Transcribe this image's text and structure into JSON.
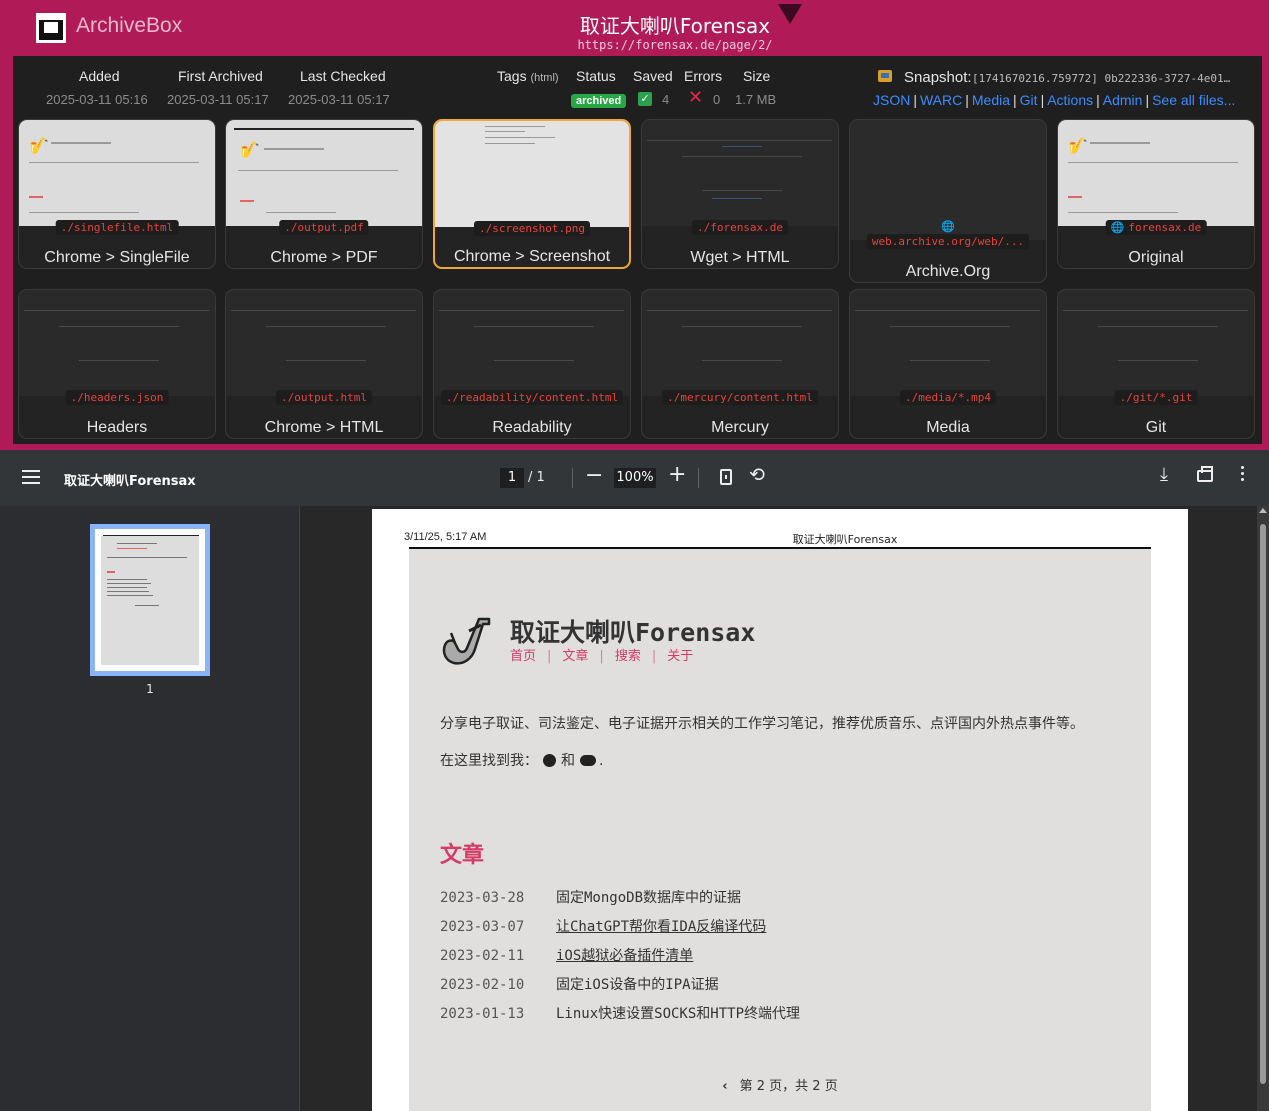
{
  "archivebox": {
    "brand": "ArchiveBox",
    "title": "取证大喇叭Forensax",
    "url": "https://forensax.de/page/2/",
    "meta": {
      "added_label": "Added",
      "added": "2025-03-11 05:16",
      "first_label": "First Archived",
      "first": "2025-03-11 05:17",
      "last_label": "Last Checked",
      "last": "2025-03-11 05:17",
      "tags_label": "Tags",
      "tags_sub": "(html)",
      "status_label": "Status",
      "status": "archived",
      "saved_label": "Saved",
      "saved": "4",
      "errors_label": "Errors",
      "errors": "0",
      "size_label": "Size",
      "size": "1.7 MB"
    },
    "snapshot": {
      "label": "Snapshot:",
      "id": "[1741670216.759772] 0b222336-3727-4e01-8fdd…",
      "links": [
        "JSON",
        "WARC",
        "Media",
        "Git",
        "Actions",
        "Admin",
        "See all files..."
      ]
    },
    "cards": [
      {
        "path": "./singlefile.html",
        "label": "Chrome > SingleFile"
      },
      {
        "path": "./output.pdf",
        "label": "Chrome > PDF"
      },
      {
        "path": "./screenshot.png",
        "label": "Chrome > Screenshot"
      },
      {
        "path": "./forensax.de",
        "label": "Wget > HTML"
      },
      {
        "path": "web.archive.org/web/...",
        "label": "Archive.Org"
      },
      {
        "path": "forensax.de",
        "label": "Original"
      },
      {
        "path": "./headers.json",
        "label": "Headers"
      },
      {
        "path": "./output.html",
        "label": "Chrome > HTML"
      },
      {
        "path": "./readability/content.html",
        "label": "Readability"
      },
      {
        "path": "./mercury/content.html",
        "label": "Mercury"
      },
      {
        "path": "./media/*.mp4",
        "label": "Media"
      },
      {
        "path": "./git/*.git",
        "label": "Git"
      }
    ]
  },
  "pdf_toolbar": {
    "title": "取证大喇叭Forensax",
    "page": "1",
    "of": "/  1",
    "zoom": "100%",
    "minus_icon": "−",
    "plus_icon": "+",
    "rotate_icon": "⟲",
    "download_icon": "⤓"
  },
  "sidebar": {
    "thumb_number": "1"
  },
  "pdf_page": {
    "header_date": "3/11/25, 5:17 AM",
    "header_title": "取证大喇叭Forensax",
    "site_title": "取证大喇叭Forensax",
    "nav": [
      "首页",
      "文章",
      "搜索",
      "关于"
    ],
    "description": "分享电子取证、司法鉴定、电子证据开示相关的工作学习笔记，推荐优质音乐、点评国内外热点事件等。",
    "find_text": "在这里找到我：",
    "find_and": "和",
    "find_end": ".",
    "section_title": "文章",
    "posts": [
      {
        "date": "2023-03-28",
        "title": "固定MongoDB数据库中的证据"
      },
      {
        "date": "2023-03-07",
        "title": "让ChatGPT帮你看IDA反编译代码"
      },
      {
        "date": "2023-02-11",
        "title": "iOS越狱必备插件清单"
      },
      {
        "date": "2023-02-10",
        "title": "固定iOS设备中的IPA证据"
      },
      {
        "date": "2023-01-13",
        "title": "Linux快速设置SOCKS和HTTP终端代理"
      }
    ],
    "pager_text": "第 2 页，共 2 页"
  }
}
